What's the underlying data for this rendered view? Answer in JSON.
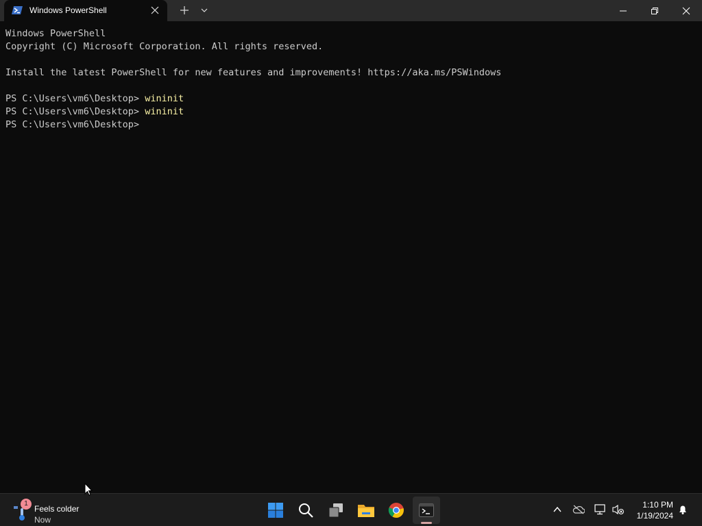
{
  "window": {
    "tab_title": "Windows PowerShell",
    "accent_color": "#0c0c0c",
    "titlebar_color": "#2b2b2b"
  },
  "terminal": {
    "lines": [
      {
        "prompt": "Windows PowerShell",
        "command": ""
      },
      {
        "prompt": "Copyright (C) Microsoft Corporation. All rights reserved.",
        "command": ""
      },
      {
        "prompt": "",
        "command": ""
      },
      {
        "prompt": "Install the latest PowerShell for new features and improvements! https://aka.ms/PSWindows",
        "command": ""
      },
      {
        "prompt": "",
        "command": ""
      },
      {
        "prompt": "PS C:\\Users\\vm6\\Desktop> ",
        "command": "wininit"
      },
      {
        "prompt": "PS C:\\Users\\vm6\\Desktop> ",
        "command": "wininit"
      },
      {
        "prompt": "PS C:\\Users\\vm6\\Desktop> ",
        "command": ""
      }
    ],
    "text_color": "#cccccc",
    "command_color": "#f9f1a5"
  },
  "taskbar": {
    "weather": {
      "badge": "1",
      "title": "Feels colder",
      "subtitle": "Now"
    },
    "apps": [
      {
        "name": "start-icon"
      },
      {
        "name": "search-icon"
      },
      {
        "name": "task-view-icon"
      },
      {
        "name": "file-explorer-icon"
      },
      {
        "name": "chrome-icon"
      },
      {
        "name": "terminal-icon"
      }
    ],
    "clock": {
      "time": "1:10 PM",
      "date": "1/19/2024"
    }
  }
}
